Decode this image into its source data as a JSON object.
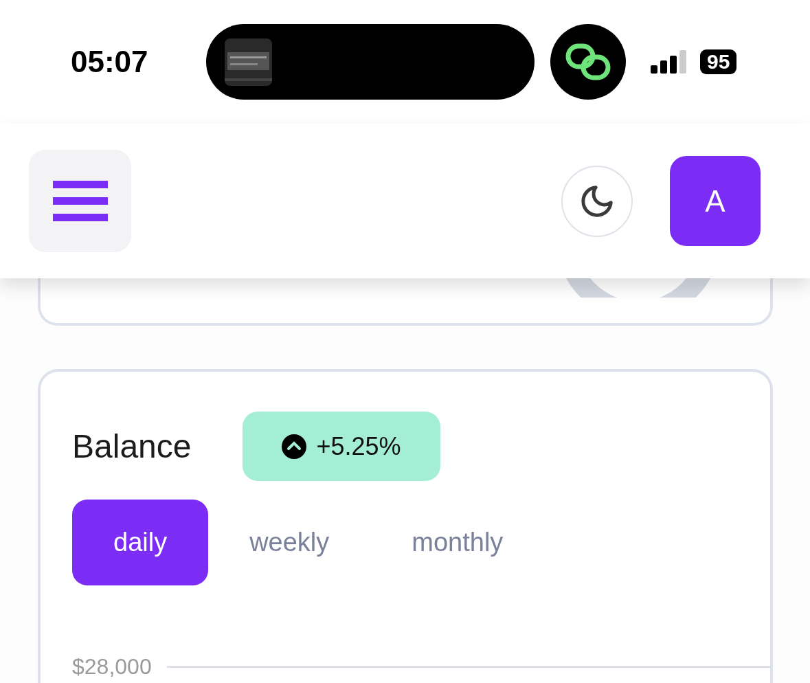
{
  "status_bar": {
    "time": "05:07",
    "battery": "95"
  },
  "header": {
    "avatar_letter": "A"
  },
  "balance": {
    "title": "Balance",
    "change": "+5.25%",
    "rising": true,
    "periods": [
      {
        "label": "daily",
        "selected": true
      },
      {
        "label": "weekly",
        "selected": false
      },
      {
        "label": "monthly",
        "selected": false
      }
    ],
    "y_label": "$28,000"
  }
}
